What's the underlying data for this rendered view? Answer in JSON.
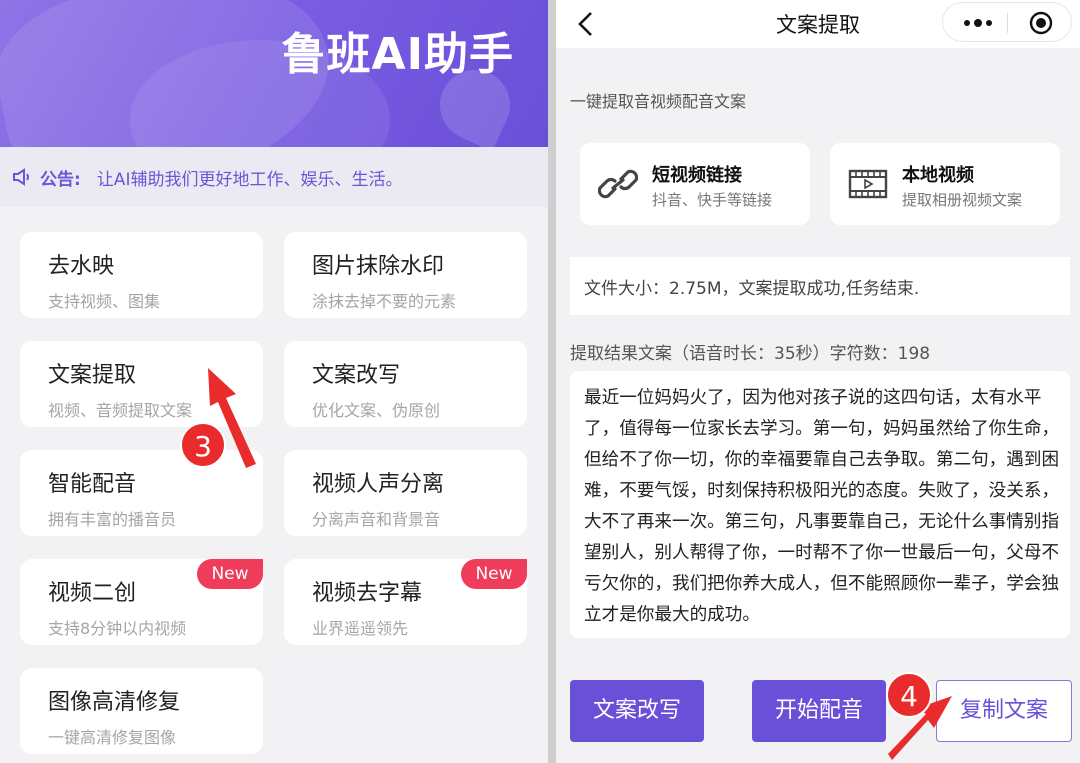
{
  "left": {
    "banner_title": "鲁班AI助手",
    "notice": {
      "label": "公告:",
      "text": "让AI辅助我们更好地工作、娱乐、生活。"
    },
    "tools": [
      {
        "title": "去水映",
        "subtitle": "支持视频、图集"
      },
      {
        "title": "图片抹除水印",
        "subtitle": "涂抹去掉不要的元素"
      },
      {
        "title": "文案提取",
        "subtitle": "视频、音频提取文案"
      },
      {
        "title": "文案改写",
        "subtitle": "优化文案、伪原创"
      },
      {
        "title": "智能配音",
        "subtitle": "拥有丰富的播音员"
      },
      {
        "title": "视频人声分离",
        "subtitle": "分离声音和背景音"
      },
      {
        "title": "视频二创",
        "subtitle": "支持8分钟以内视频",
        "badge": "New"
      },
      {
        "title": "视频去字幕",
        "subtitle": "业界遥遥领先",
        "badge": "New"
      },
      {
        "title": "图像高清修复",
        "subtitle": "一键高清修复图像"
      }
    ]
  },
  "right": {
    "nav_title": "文案提取",
    "tip": "一键提取音视频配音文案",
    "sources": [
      {
        "title": "短视频链接",
        "subtitle": "抖音、快手等链接",
        "icon": "link-icon"
      },
      {
        "title": "本地视频",
        "subtitle": "提取相册视频文案",
        "icon": "film-icon"
      }
    ],
    "status": "文件大小：2.75M，文案提取成功,任务结束.",
    "result_label": "提取结果文案（语音时长：35秒）字符数：198",
    "result_text": "最近一位妈妈火了，因为他对孩子说的这四句话，太有水平了，值得每一位家长去学习。第一句，妈妈虽然给了你生命，但给不了你一切，你的幸福要靠自己去争取。第二句，遇到困难，不要气馁，时刻保持积极阳光的态度。失败了，没关系，大不了再来一次。第三句，凡事要靠自己，无论什么事情别指望别人，别人帮得了你，一时帮不了你一世最后一句，父母不亏欠你的，我们把你养大成人，但不能照顾你一辈子，学会独立才是你最大的成功。",
    "buttons": {
      "rewrite": "文案改写",
      "dub": "开始配音",
      "copy": "复制文案"
    }
  },
  "annotations": {
    "step3": "3",
    "step4": "4"
  },
  "colors": {
    "accent": "#6a4fd8",
    "badge": "#ef3c5a",
    "marker": "#ea2b2b"
  }
}
